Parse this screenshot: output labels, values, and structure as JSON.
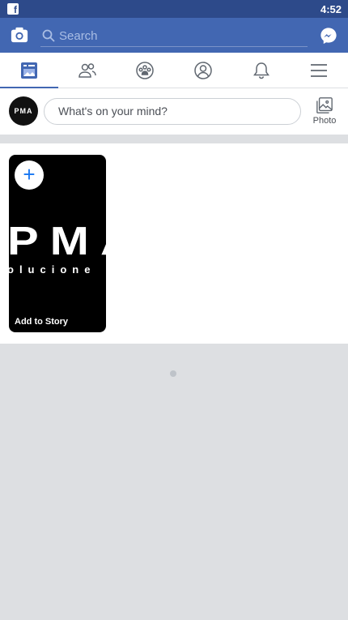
{
  "status_bar": {
    "time": "4:52",
    "app_icon": "facebook-icon"
  },
  "header": {
    "search_placeholder": "Search",
    "left_icon": "camera-icon",
    "right_icon": "messenger-icon",
    "colors": {
      "header_bg": "#4267b2",
      "status_bg": "#2d4a8a"
    }
  },
  "tabs": [
    {
      "name": "news-feed",
      "icon": "news-feed-icon",
      "active": true
    },
    {
      "name": "friends",
      "icon": "friends-icon",
      "active": false
    },
    {
      "name": "groups",
      "icon": "groups-icon",
      "active": false
    },
    {
      "name": "profile",
      "icon": "profile-icon",
      "active": false
    },
    {
      "name": "notifications",
      "icon": "bell-icon",
      "active": false
    },
    {
      "name": "menu",
      "icon": "menu-icon",
      "active": false
    }
  ],
  "composer": {
    "avatar_text": "PMA",
    "prompt": "What's on your mind?",
    "photo_label": "Photo"
  },
  "stories": {
    "add_label": "Add to Story",
    "card_big_text": "PMA",
    "card_small_text": "olucione"
  }
}
